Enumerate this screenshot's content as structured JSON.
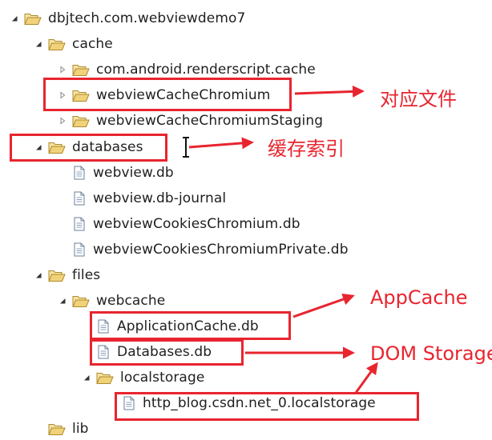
{
  "tree": {
    "root": "dbjtech.com.webviewdemo7",
    "cache": "cache",
    "cache_children": [
      "com.android.renderscript.cache",
      "webviewCacheChromium",
      "webviewCacheChromiumStaging"
    ],
    "databases": "databases",
    "databases_children": [
      "webview.db",
      "webview.db-journal",
      "webviewCookiesChromium.db",
      "webviewCookiesChromiumPrivate.db"
    ],
    "files": "files",
    "webcache": "webcache",
    "webcache_children": [
      "ApplicationCache.db",
      "Databases.db"
    ],
    "localstorage": "localstorage",
    "localstorage_child": "http_blog.csdn.net_0.localstorage",
    "lib": "lib"
  },
  "annotations": {
    "cache_files": "对应文件",
    "cache_index": "缓存索引",
    "appcache": "AppCache",
    "dom_storage": "DOM Storage"
  },
  "colors": {
    "highlight": "#e8252f",
    "folder_fill": "#f0d27a",
    "folder_stroke": "#b08a2a"
  },
  "icons": {
    "expanded": "triangle-down-icon",
    "collapsed": "triangle-right-icon",
    "folder": "folder-open-icon",
    "file": "file-icon"
  }
}
